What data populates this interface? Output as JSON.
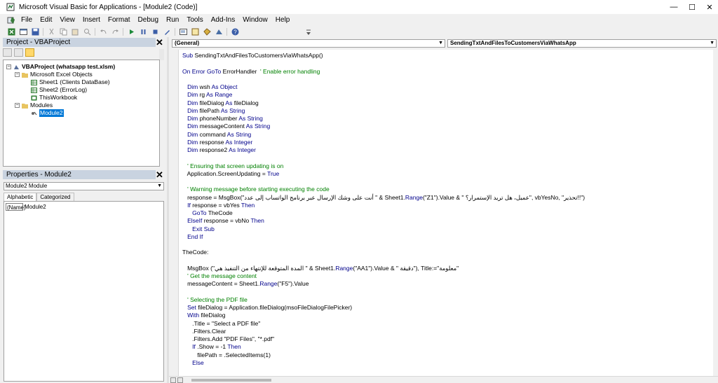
{
  "window": {
    "title": "Microsoft Visual Basic for Applications - [Module2 (Code)]",
    "minimize": "—",
    "maximize": "☐",
    "close": "✕"
  },
  "menubar": {
    "items": [
      "File",
      "Edit",
      "View",
      "Insert",
      "Format",
      "Debug",
      "Run",
      "Tools",
      "Add-Ins",
      "Window",
      "Help"
    ]
  },
  "project_panel": {
    "title": "Project - VBAProject",
    "close": "✕",
    "tree": {
      "root": "VBAProject (whatsapp test.xlsm)",
      "excel_objects": "Microsoft Excel Objects",
      "sheet1": "Sheet1 (Clients DataBase)",
      "sheet2": "Sheet2 (ErrorLog)",
      "thisworkbook": "ThisWorkbook",
      "modules": "Modules",
      "module2": "Module2"
    }
  },
  "properties_panel": {
    "title": "Properties - Module2",
    "close": "✕",
    "object_combo": "Module2  Module",
    "tabs": [
      "Alphabetic",
      "Categorized"
    ],
    "property_name": "(Name)",
    "property_value": "Module2"
  },
  "code_window": {
    "object_combo": "(General)",
    "procedure_combo": "SendingTxtAndFilesToCustomersViaWhatsApp",
    "lines": [
      {
        "text": "Sub SendingTxtAndFilesToCustomersViaWhatsApp()",
        "type": "code"
      },
      {
        "text": "",
        "type": "blank"
      },
      {
        "text": "On Error GoTo ErrorHandler  ' Enable error handling",
        "type": "code"
      },
      {
        "text": "",
        "type": "blank"
      },
      {
        "text": "   Dim wsh As Object",
        "type": "code"
      },
      {
        "text": "   Dim rg As Range",
        "type": "code"
      },
      {
        "text": "   Dim fileDialog As fileDialog",
        "type": "code"
      },
      {
        "text": "   Dim filePath As String",
        "type": "code"
      },
      {
        "text": "   Dim phoneNumber As String",
        "type": "code"
      },
      {
        "text": "   Dim messageContent As String",
        "type": "code"
      },
      {
        "text": "   Dim command As String",
        "type": "code"
      },
      {
        "text": "   Dim response As Integer",
        "type": "code"
      },
      {
        "text": "   Dim response2 As Integer",
        "type": "code"
      },
      {
        "text": "",
        "type": "blank"
      },
      {
        "text": "   ' Ensuring that screen updating is on",
        "type": "comment"
      },
      {
        "text": "   Application.ScreenUpdating = True",
        "type": "code"
      },
      {
        "text": "",
        "type": "blank"
      },
      {
        "text": "   ' Warning message before starting executing the code",
        "type": "comment"
      },
      {
        "text": "   response = MsgBox(\"أنت على وشك الإرسال عبر برنامج الواتساب إلى عدد \" & Sheet1.Range(\"Z1\").Value & \" عميل، هل تريد الإستمرار؟\", vbYesNo, \"تحذير!!\")",
        "type": "code"
      },
      {
        "text": "   If response = vbYes Then",
        "type": "code"
      },
      {
        "text": "      GoTo TheCode",
        "type": "code"
      },
      {
        "text": "   ElseIf response = vbNo Then",
        "type": "code"
      },
      {
        "text": "      Exit Sub",
        "type": "code"
      },
      {
        "text": "   End If",
        "type": "code"
      },
      {
        "text": "",
        "type": "blank"
      },
      {
        "text": "TheCode:",
        "type": "code"
      },
      {
        "text": "",
        "type": "blank"
      },
      {
        "text": "   MsgBox (\"المدة المتوقعة للإنتهاء من التنفيذ هي \" & Sheet1.Range(\"AA1\").Value & \" دقيقة\"), Title:=\"معلومة\"",
        "type": "code"
      },
      {
        "text": "   ' Get the message content",
        "type": "comment"
      },
      {
        "text": "   messageContent = Sheet1.Range(\"F5\").Value",
        "type": "code"
      },
      {
        "text": "",
        "type": "blank"
      },
      {
        "text": "   ' Selecting the PDF file",
        "type": "comment"
      },
      {
        "text": "   Set fileDialog = Application.fileDialog(msoFileDialogFilePicker)",
        "type": "code"
      },
      {
        "text": "   With fileDialog",
        "type": "code"
      },
      {
        "text": "      .Title = \"Select a PDF file\"",
        "type": "code"
      },
      {
        "text": "      .Filters.Clear",
        "type": "code"
      },
      {
        "text": "      .Filters.Add \"PDF Files\", \"*.pdf\"",
        "type": "code"
      },
      {
        "text": "      If .Show = -1 Then",
        "type": "code"
      },
      {
        "text": "         filePath = .SelectedItems(1)",
        "type": "code"
      },
      {
        "text": "      Else",
        "type": "code"
      }
    ]
  },
  "colors": {
    "keyword": "#00008b",
    "comment": "#008000",
    "panel_title_bg": "#c9d3e0",
    "selection": "#0078d7"
  }
}
